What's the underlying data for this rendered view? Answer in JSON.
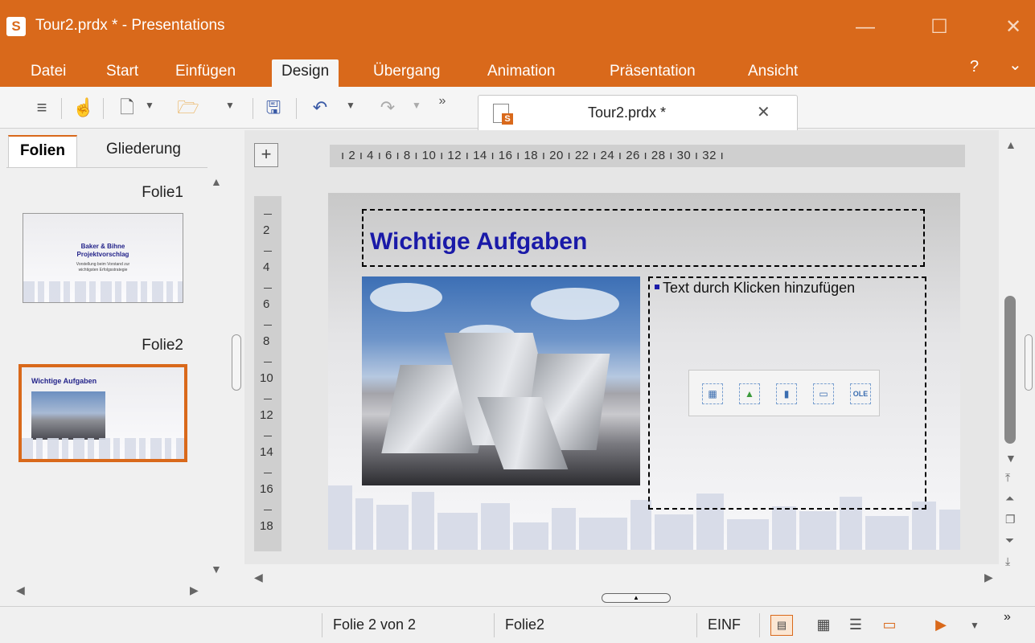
{
  "window": {
    "app_icon": "S",
    "title": "Tour2.prdx * - Presentations",
    "controls": [
      "—",
      "☐",
      "✕"
    ]
  },
  "menu": {
    "items": [
      "Datei",
      "Start",
      "Einfügen",
      "Design",
      "Übergang",
      "Animation",
      "Präsentation",
      "Ansicht"
    ],
    "active": "Design",
    "help": "?",
    "collapse": "⌄"
  },
  "toolbar": {
    "icons": [
      "hamburger-menu-icon",
      "hand-pointer-icon",
      "new-file-icon",
      "open-folder-icon",
      "save-icon",
      "undo-icon",
      "redo-icon",
      "more-icon"
    ],
    "more_label": "»"
  },
  "document_tab": {
    "title": "Tour2.prdx *",
    "close": "✕"
  },
  "left_pane": {
    "tabs": [
      "Folien",
      "Gliederung"
    ],
    "active_tab": "Folien",
    "slides": [
      {
        "label": "Folie1",
        "thumb_lines": [
          "Baker & Bihne",
          "Projektvorschlag",
          "Vorstellung beim Vorstand zur",
          "wichtigsten Erfolgsstrategie"
        ]
      },
      {
        "label": "Folie2",
        "thumb_title": "Wichtige Aufgaben"
      }
    ]
  },
  "editor": {
    "corner_icon": "+",
    "hruler_text": "ı 2 ı 4 ı 6 ı 8 ı 10 ı 12 ı 14 ı 16 ı 18 ı 20 ı 22 ı 24 ı 26 ı 28 ı 30 ı 32 ı",
    "vruler_numbers": [
      "2",
      "4",
      "6",
      "8",
      "10",
      "12",
      "14",
      "16",
      "18"
    ],
    "slide": {
      "title": "Wichtige Aufgaben",
      "placeholder": "Text durch Klicken hinzufügen",
      "insert_icons": [
        "table-icon",
        "image-icon",
        "chart-icon",
        "textframe-icon",
        "ole-icon"
      ],
      "insert_labels": [
        "▦",
        "▲",
        "▮",
        "▭",
        "OLE"
      ]
    }
  },
  "statusbar": {
    "slide_position": "Folie 2 von 2",
    "slide_name": "Folie2",
    "mode": "EINF",
    "more": "»"
  }
}
